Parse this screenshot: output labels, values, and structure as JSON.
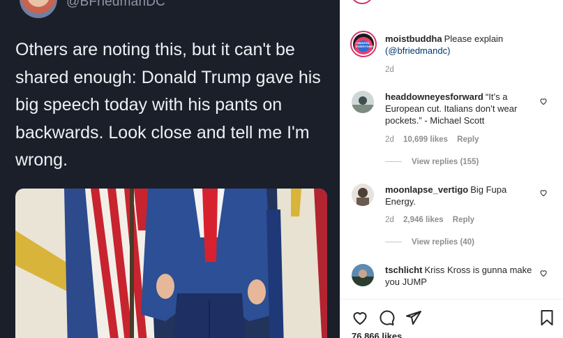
{
  "tweet": {
    "handle": "@BFriedmanDC",
    "text": "Others are noting this, but it can't be shared enough: Donald Trump gave his big speech today with his pants on backwards. Look close and tell me I'm wrong."
  },
  "comments": [
    {
      "username": "moistbuddha",
      "text": "Please explain",
      "mention": "(@bfriedmandc)",
      "time": "2d"
    },
    {
      "username": "headdowneyesforward",
      "text": "“It’s a European cut. Italians don’t wear pockets.” - Michael Scott",
      "time": "2d",
      "likes": "10,699 likes",
      "reply": "Reply",
      "view_replies": "View replies (155)"
    },
    {
      "username": "moonlapse_vertigo",
      "text": "Big Fupa Energy.",
      "time": "2d",
      "likes": "2,946 likes",
      "reply": "Reply",
      "view_replies": "View replies (40)"
    },
    {
      "username": "tschlicht",
      "text": "Kriss Kross is gunna make you JUMP"
    }
  ],
  "likes_total": "76,866 likes",
  "icons": [
    "heart-icon",
    "comment-icon",
    "share-icon",
    "bookmark-icon"
  ],
  "colors": {
    "story_ring": "#d6336c",
    "link": "#00376b",
    "meta": "#8e8e8e",
    "tweet_bg": "#1b1f2a"
  }
}
